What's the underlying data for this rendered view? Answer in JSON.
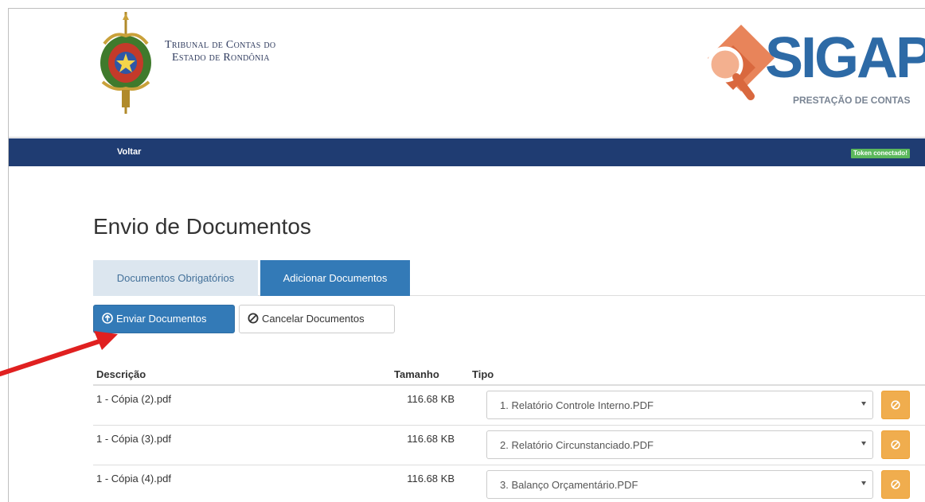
{
  "header": {
    "tribunal_line1": "Tribunal de Contas do",
    "tribunal_line2": "Estado de Rondônia",
    "logo_text": "SIGAP",
    "logo_subtitle": "PRESTAÇÃO DE CONTAS"
  },
  "navbar": {
    "back_label": "Voltar",
    "token_status": "Token conectado!"
  },
  "page": {
    "title": "Envio de Documentos"
  },
  "tabs": [
    {
      "label": "Documentos Obrigatórios",
      "active": false
    },
    {
      "label": "Adicionar Documentos",
      "active": true
    }
  ],
  "actions": {
    "send_label": "Enviar Documentos",
    "send_icon": "arrow-up-circle-icon",
    "cancel_label": "Cancelar Documentos",
    "cancel_icon": "ban-icon"
  },
  "table": {
    "columns": [
      "Descrição",
      "Tamanho",
      "Tipo"
    ],
    "rows": [
      {
        "description": "1 - Cópia (2).pdf",
        "size": "116.68 KB",
        "type": "1. Relatório Controle Interno.PDF"
      },
      {
        "description": "1 - Cópia (3).pdf",
        "size": "116.68 KB",
        "type": "2. Relatório Circunstanciado.PDF"
      },
      {
        "description": "1 - Cópia (4).pdf",
        "size": "116.68 KB",
        "type": "3. Balanço Orçamentário.PDF"
      }
    ]
  },
  "colors": {
    "navbar": "#1f3c72",
    "primary": "#337ab7",
    "warning": "#f0ad4e",
    "success": "#5cb85c",
    "annotation_arrow": "#e02020"
  }
}
